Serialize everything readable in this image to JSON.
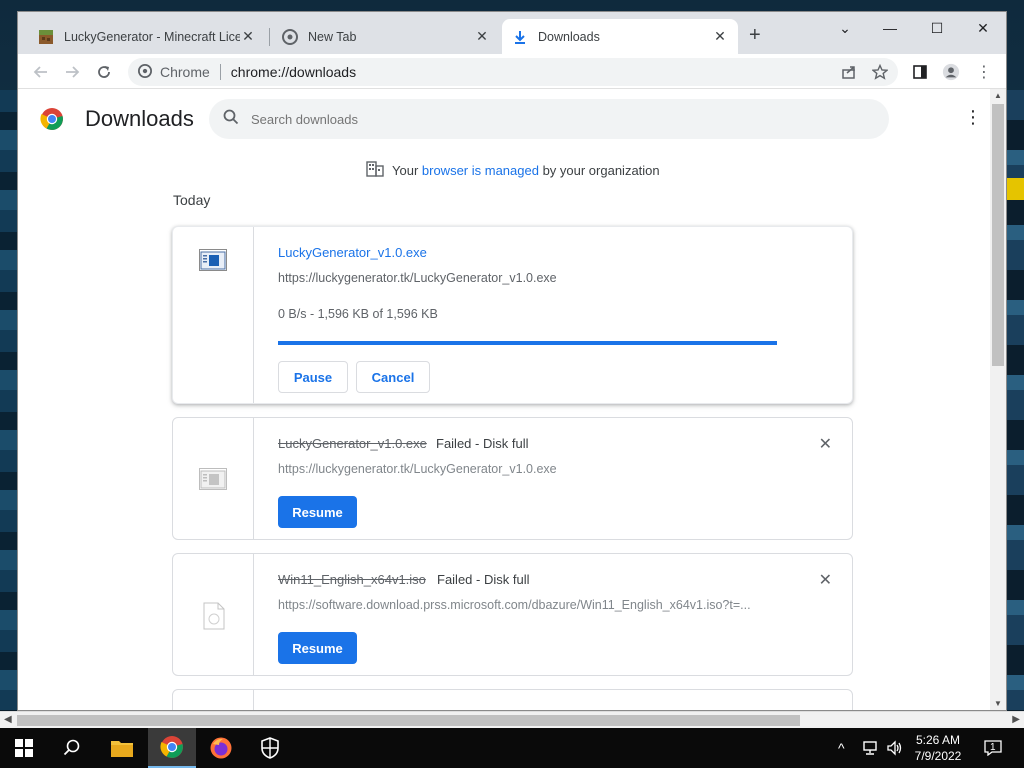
{
  "tabs": [
    {
      "title": "LuckyGenerator - Minecraft Licen",
      "favicon": "minecraft-block-icon",
      "active": false
    },
    {
      "title": "New Tab",
      "favicon": "chrome-icon",
      "active": false
    },
    {
      "title": "Downloads",
      "favicon": "download-icon",
      "active": true
    }
  ],
  "omnibox": {
    "site_label": "Chrome",
    "url": "chrome://downloads"
  },
  "downloads_page": {
    "title": "Downloads",
    "search_placeholder": "Search downloads",
    "managed_prefix": "Your ",
    "managed_link": "browser is managed",
    "managed_suffix": " by your organization",
    "section": "Today",
    "items": [
      {
        "file_name": "LuckyGenerator_v1.0.exe",
        "url": "https://luckygenerator.tk/LuckyGenerator_v1.0.exe",
        "progress_text": "0 B/s - 1,596 KB of 1,596 KB",
        "progress": 1.0,
        "pause_label": "Pause",
        "cancel_label": "Cancel"
      },
      {
        "file_name": "LuckyGenerator_v1.0.exe",
        "status": "Failed - Disk full",
        "url": "https://luckygenerator.tk/LuckyGenerator_v1.0.exe",
        "resume_label": "Resume"
      },
      {
        "file_name": "Win11_English_x64v1.iso",
        "status": "Failed - Disk full",
        "url": "https://software.download.prss.microsoft.com/dbazure/Win11_English_x64v1.iso?t=...",
        "resume_label": "Resume"
      }
    ]
  },
  "taskbar": {
    "time": "5:26 AM",
    "date": "7/9/2022",
    "notification_count": "1"
  },
  "colors": {
    "accent": "#1a73e8",
    "tabstrip": "#dee1e6"
  }
}
